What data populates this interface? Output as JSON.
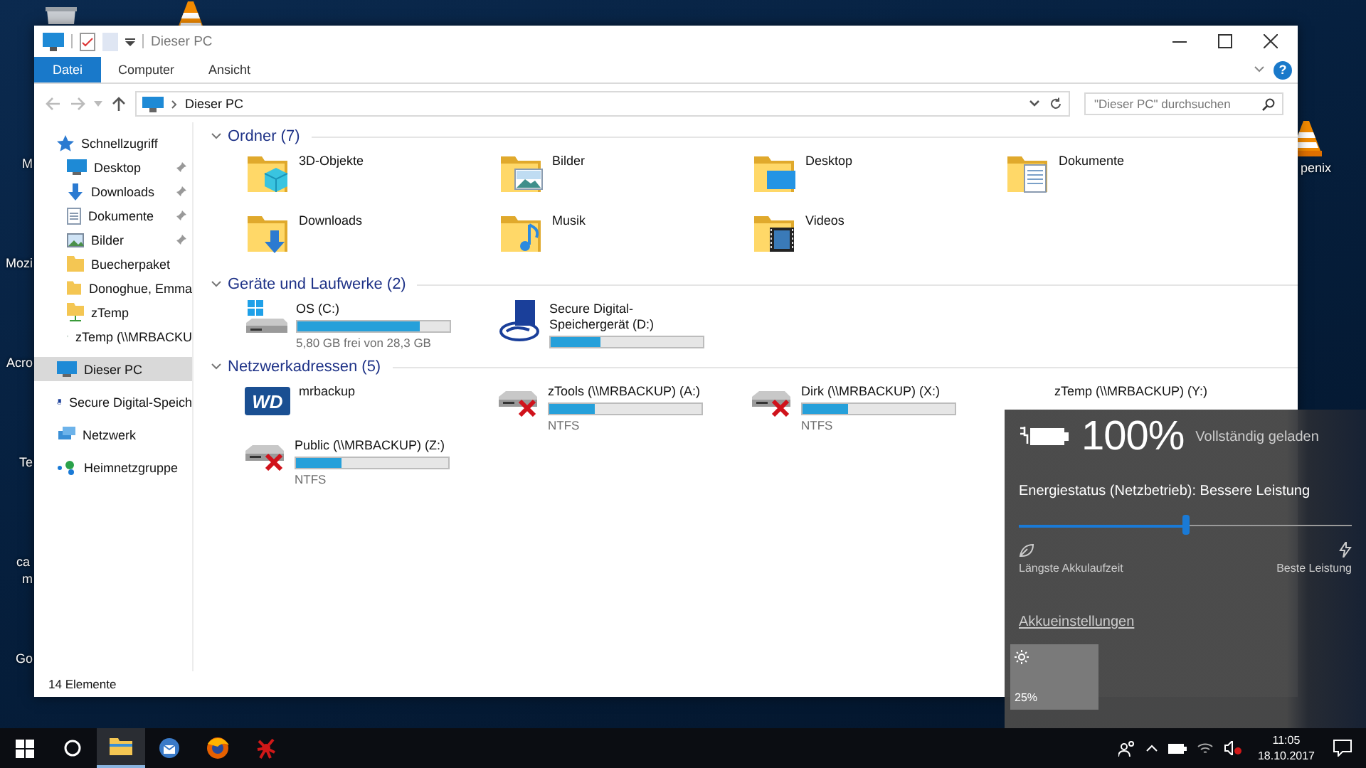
{
  "desktop": {
    "left_labels": [
      "M",
      "Mozi",
      "Acro",
      "Te",
      "ca",
      "m",
      "Go"
    ],
    "right_labels": [
      "penix"
    ]
  },
  "window": {
    "title": "Dieser PC"
  },
  "ribbon": {
    "tabs": [
      {
        "label": "Datei",
        "kind": "file",
        "selected": false
      },
      {
        "label": "Computer",
        "kind": "tab",
        "selected": false
      },
      {
        "label": "Ansicht",
        "kind": "tab",
        "selected": false
      }
    ],
    "help": "?"
  },
  "address_bar": {
    "path": [
      "Dieser PC"
    ]
  },
  "search": {
    "placeholder": "\"Dieser PC\" durchsuchen"
  },
  "sidebar": {
    "items": [
      {
        "label": "Schnellzugriff",
        "selected": false,
        "children": [
          {
            "label": "Desktop",
            "selected": false,
            "pinned": true
          },
          {
            "label": "Downloads",
            "selected": false,
            "pinned": true
          },
          {
            "label": "Dokumente",
            "selected": false,
            "pinned": true
          },
          {
            "label": "Bilder",
            "selected": false,
            "pinned": true
          },
          {
            "label": "Buecherpaket",
            "selected": false,
            "pinned": false
          },
          {
            "label": "Donoghue, Emma",
            "selected": false,
            "pinned": false
          },
          {
            "label": "zTemp",
            "selected": false,
            "pinned": false
          },
          {
            "label": "zTemp (\\\\MRBACKU",
            "selected": false,
            "pinned": false
          }
        ]
      },
      {
        "label": "Dieser PC",
        "selected": true
      },
      {
        "label": "Secure Digital-Speich",
        "selected": false
      },
      {
        "label": "Netzwerk",
        "selected": false
      },
      {
        "label": "Heimnetzgruppe",
        "selected": false
      }
    ]
  },
  "groups": [
    {
      "title": "Ordner (7)",
      "expanded": true,
      "items": [
        {
          "kind": "folder",
          "name": "3D-Objekte"
        },
        {
          "kind": "folder",
          "name": "Bilder"
        },
        {
          "kind": "folder",
          "name": "Desktop"
        },
        {
          "kind": "folder",
          "name": "Dokumente"
        },
        {
          "kind": "folder",
          "name": "Downloads"
        },
        {
          "kind": "folder",
          "name": "Musik"
        },
        {
          "kind": "folder",
          "name": "Videos"
        }
      ]
    },
    {
      "title": "Geräte und Laufwerke (2)",
      "expanded": true,
      "items": [
        {
          "kind": "drive",
          "name": "OS (C:)",
          "level": 0.8,
          "detail": "5,80 GB frei von 28,3 GB"
        },
        {
          "kind": "drive",
          "name": "Secure Digital-Speichergerät (D:)",
          "level": 0.33
        }
      ]
    },
    {
      "title": "Netzwerkadressen (5)",
      "expanded": true,
      "items": [
        {
          "kind": "location",
          "name": "mrbackup",
          "logo": "WD"
        },
        {
          "kind": "drive",
          "name": "zTools (\\\\MRBACKUP) (A:)",
          "level": 0.3,
          "detail": "NTFS",
          "disconnected": true
        },
        {
          "kind": "drive",
          "name": "Dirk (\\\\MRBACKUP) (X:)",
          "level": 0.3,
          "detail": "NTFS",
          "disconnected": true
        },
        {
          "kind": "drive",
          "name": "zTemp (\\\\MRBACKUP) (Y:)"
        },
        {
          "kind": "drive",
          "name": "Public (\\\\MRBACKUP) (Z:)",
          "level": 0.3,
          "detail": "NTFS",
          "disconnected": true
        }
      ]
    }
  ],
  "status_bar": {
    "count": "14 Elemente"
  },
  "battery_flyout": {
    "percent": "100%",
    "status": "Vollständig geladen",
    "power_mode": "Energiestatus (Netzbetrieb): Bessere Leistung",
    "slider": {
      "level": 0.5
    },
    "min_label": "Längste Akkulaufzeit",
    "max_label": "Beste Leistung",
    "settings_link": "Akkueinstellungen",
    "tiles": [
      {
        "label": "25%"
      }
    ]
  },
  "taskbar": {
    "apps": [
      {
        "running": true
      },
      {
        "running": false
      },
      {
        "running": false
      },
      {
        "running": false
      }
    ],
    "time": "11:05",
    "date": "18.10.2017"
  }
}
